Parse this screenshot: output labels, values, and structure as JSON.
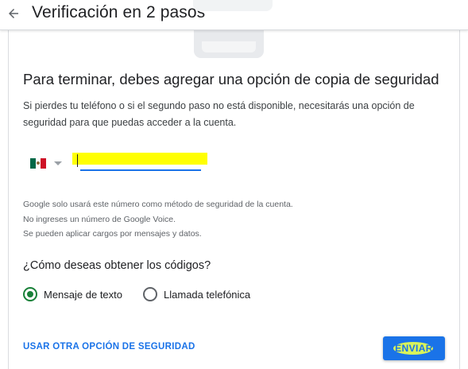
{
  "header": {
    "title": "Verificación en 2 pasos",
    "back_icon": "arrow-back-icon"
  },
  "main": {
    "heading": "Para terminar, debes agregar una opción de copia de seguridad",
    "description": "Si pierdes tu teléfono o si el segundo paso no está disponible, necesitarás una opción de seguridad para que puedas acceder a la cuenta.",
    "phone": {
      "country_flag": "mexico-flag-icon",
      "dropdown_icon": "dropdown-caret-icon",
      "value": "",
      "highlight_color": "#ffff00"
    },
    "notes": [
      "Google solo usará este número como método de seguridad de la cuenta.",
      "No ingreses un número de Google Voice.",
      "Se pueden aplicar cargos por mensajes y datos."
    ],
    "question": "¿Cómo deseas obtener los códigos?",
    "options": [
      {
        "label": "Mensaje de texto",
        "selected": true
      },
      {
        "label": "Llamada telefónica",
        "selected": false
      }
    ]
  },
  "footer": {
    "alt_link": "USAR OTRA OPCIÓN DE SEGURIDAD",
    "send_button": "ENVIAR"
  },
  "colors": {
    "accent": "#1a73e8",
    "radio_selected": "#188038",
    "send_highlight": "#d7f35b"
  }
}
